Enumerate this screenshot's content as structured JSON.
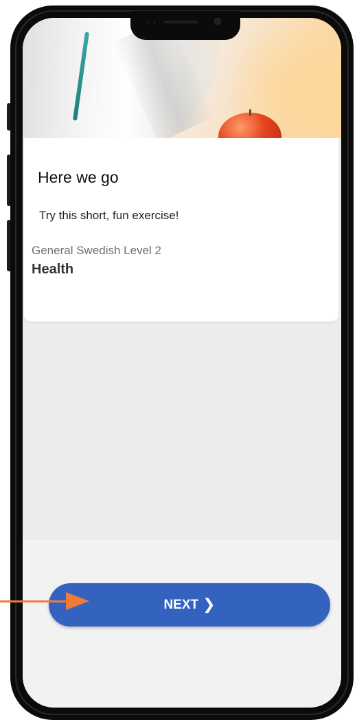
{
  "card": {
    "title": "Here we go",
    "subtitle": "Try this short, fun exercise!",
    "course_level": "General Swedish Level 2",
    "course_topic": "Health"
  },
  "footer": {
    "next_label": "NEXT",
    "next_icon": "chevron-right-icon"
  },
  "hero": {
    "image": "doctor-with-apple-photo"
  },
  "colors": {
    "button": "#3362bf",
    "annotation_arrow": "#f07c36",
    "screen_bg": "#ececec"
  }
}
